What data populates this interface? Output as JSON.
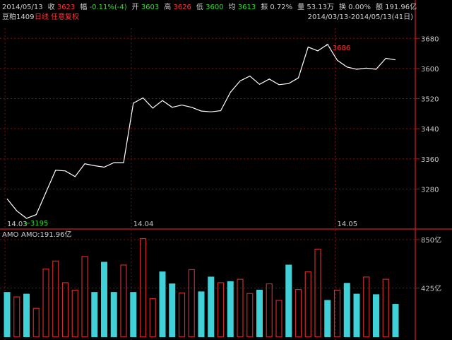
{
  "header": {
    "items": [
      {
        "label": "",
        "value": "2014/05/13",
        "value_color": "#d0d0d0"
      },
      {
        "label": "收",
        "value": "3623",
        "value_color": "#ff3333"
      },
      {
        "label": "幅",
        "value": "-0.11%(-4)",
        "value_color": "#33dd33"
      },
      {
        "label": "开",
        "value": "3603",
        "value_color": "#33dd33"
      },
      {
        "label": "高",
        "value": "3626",
        "value_color": "#ff3333"
      },
      {
        "label": "低",
        "value": "3600",
        "value_color": "#33dd33"
      },
      {
        "label": "均",
        "value": "3613",
        "value_color": "#33dd33"
      },
      {
        "label": "振",
        "value": "0.72%",
        "value_color": "#d0d0d0"
      },
      {
        "label": "量",
        "value": "53.13万",
        "value_color": "#d0d0d0"
      },
      {
        "label": "换",
        "value": "0.00%",
        "value_color": "#d0d0d0"
      },
      {
        "label": "额",
        "value": "191.96亿",
        "value_color": "#d0d0d0"
      }
    ],
    "symbol": "豆粕1409",
    "period": "日线",
    "adjust": "任意复权",
    "range": "2014/03/13-2014/05/13(41日)"
  },
  "colors": {
    "background": "#000000",
    "grid": "#7a1010",
    "price_line": "#ffffff",
    "axis_text": "#c8c8c8",
    "high_label": "#ff3333",
    "low_label": "#33dd33",
    "up_bar": "#cc2a2a",
    "down_bar": "#40d0d8"
  },
  "chart_data": [
    {
      "type": "line",
      "title": "",
      "ylim": [
        3200,
        3720
      ],
      "y_ticks": [
        3280,
        3360,
        3440,
        3520,
        3600,
        3680
      ],
      "x_ticks": [
        {
          "index": 0,
          "label": "14.03"
        },
        {
          "index": 13,
          "label": "14.04"
        },
        {
          "index": 34,
          "label": "14.05"
        }
      ],
      "values": [
        3254,
        3222,
        3202,
        3212,
        3271,
        3330,
        3328,
        3313,
        3347,
        3342,
        3338,
        3350,
        3350,
        3508,
        3522,
        3495,
        3515,
        3497,
        3503,
        3497,
        3487,
        3485,
        3488,
        3537,
        3567,
        3580,
        3558,
        3572,
        3557,
        3560,
        3575,
        3657,
        3647,
        3664,
        3622,
        3604,
        3598,
        3601,
        3598,
        3627,
        3623
      ],
      "annotations": [
        {
          "index": 33,
          "value": 3686,
          "text": "3686"
        },
        {
          "index": 2,
          "value": 3195,
          "text": "3195"
        }
      ]
    },
    {
      "type": "bar",
      "title": "AMO",
      "label": "AMO:191.96亿",
      "ylim": [
        0,
        850
      ],
      "y_ticks": [
        {
          "value": 425,
          "label": "425亿"
        },
        {
          "value": 850,
          "label": "850亿"
        }
      ],
      "values": [
        390,
        350,
        375,
        250,
        595,
        665,
        475,
        410,
        705,
        390,
        655,
        390,
        630,
        390,
        895,
        335,
        570,
        465,
        385,
        590,
        395,
        525,
        475,
        485,
        505,
        380,
        410,
        465,
        320,
        630,
        415,
        570,
        770,
        320,
        410,
        470,
        375,
        525,
        370,
        505,
        285
      ],
      "up": [
        false,
        true,
        false,
        true,
        true,
        true,
        true,
        true,
        true,
        false,
        false,
        false,
        true,
        false,
        true,
        true,
        false,
        false,
        true,
        true,
        false,
        false,
        true,
        false,
        true,
        true,
        false,
        true,
        true,
        false,
        true,
        true,
        true,
        false,
        true,
        false,
        false,
        true,
        false,
        true,
        false
      ]
    }
  ]
}
